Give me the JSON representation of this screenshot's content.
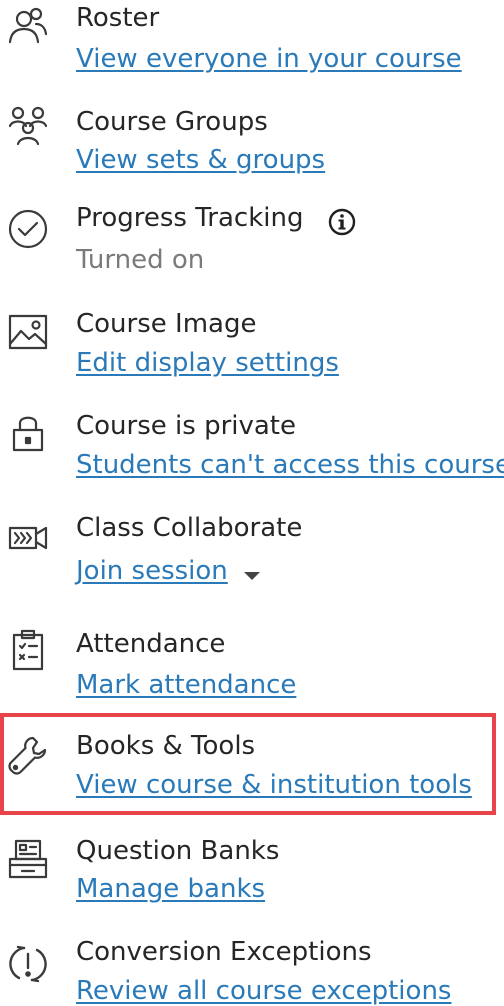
{
  "items": [
    {
      "title": "Roster",
      "link": "View everyone in your course",
      "icon": "people-icon"
    },
    {
      "title": "Course Groups",
      "link": "View sets & groups",
      "icon": "groups-icon"
    },
    {
      "title": "Progress Tracking",
      "status": "Turned on",
      "icon": "checkmark-circle-icon",
      "info_icon": "info-icon"
    },
    {
      "title": "Course Image",
      "link": "Edit display settings",
      "icon": "image-icon"
    },
    {
      "title": "Course is private",
      "link": "Students can't access this course",
      "icon": "lock-icon"
    },
    {
      "title": "Class Collaborate",
      "link": "Join session",
      "icon": "video-session-icon",
      "dropdown_icon": "chevron-down-icon"
    },
    {
      "title": "Attendance",
      "link": "Mark attendance",
      "icon": "clipboard-icon"
    },
    {
      "title": "Books & Tools",
      "link": "View course & institution tools",
      "icon": "wrench-icon",
      "highlighted": true
    },
    {
      "title": "Question Banks",
      "link": "Manage banks",
      "icon": "archive-box-icon"
    },
    {
      "title": "Conversion Exceptions",
      "link": "Review all course exceptions",
      "icon": "exclamation-sync-icon"
    }
  ],
  "colors": {
    "link": "#2a7ab9",
    "title": "#262626",
    "status": "#7a7a7a",
    "icon": "#3a3a3a",
    "highlight_border": "#e9434a"
  }
}
